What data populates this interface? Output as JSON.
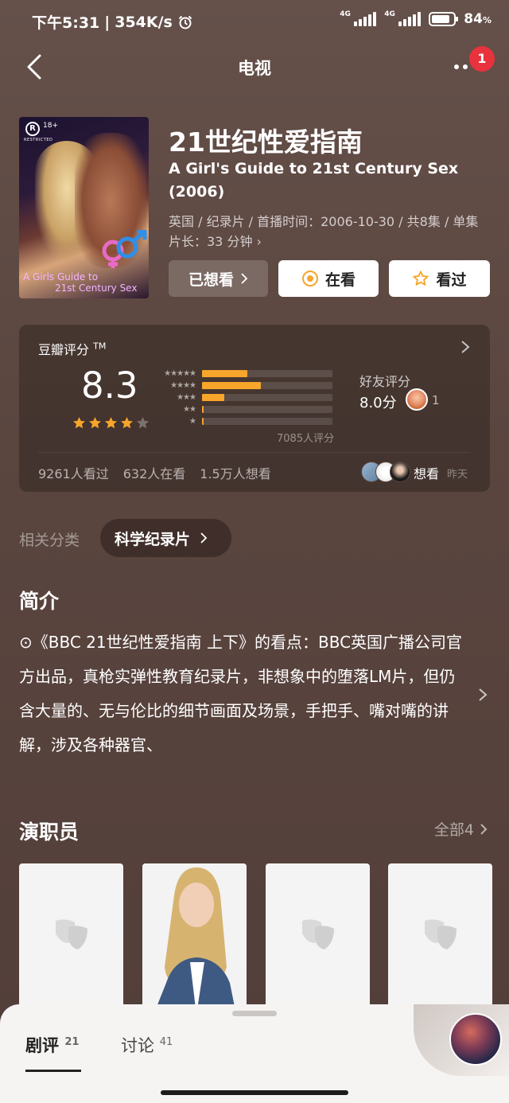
{
  "status_bar": {
    "time": "下午5:31",
    "speed": "354K/s",
    "network1": "4G",
    "network2": "4G",
    "battery": "84",
    "battery_unit": "%"
  },
  "nav": {
    "title": "电视",
    "notification_count": "1"
  },
  "poster": {
    "rating_badge": "R",
    "age": "18+",
    "restricted": "RESTRICTED",
    "line1": "A Girls Guide to",
    "line2": "21st Century Sex"
  },
  "movie": {
    "title_cn": "21世纪性爱指南",
    "title_en": "A Girl's Guide to 21st Century Sex (2006)",
    "meta": "英国 / 纪录片 / 首播时间：2006-10-30 / 共8集 / 单集片长：33 分钟 ›"
  },
  "actions": {
    "wished": "已想看",
    "watching": "在看",
    "watched": "看过"
  },
  "rating": {
    "title": "豆瓣评分",
    "tm": "TM",
    "score": "8.3",
    "stars": 4,
    "distribution": [
      0.35,
      0.45,
      0.17,
      0.015,
      0.01
    ],
    "count": "7085人评分",
    "friend_label": "好友评分",
    "friend_score": "8.0分",
    "friend_count": "1",
    "watched": "9261人看过",
    "watching": "632人在看",
    "wished": "1.5万人想看",
    "wish_label": "想看",
    "wish_time": "昨天",
    "star_color": "#f7a52b"
  },
  "category": {
    "label": "相关分类",
    "chip": "科学纪录片"
  },
  "intro": {
    "title": "简介",
    "text": "⊙《BBC 21世纪性爱指南 上下》的看点：BBC英国广播公司官方出品，真枪实弹性教育纪录片，非想象中的堕落LM片，但仍含大量的、无与伦比的细节画面及场景，手把手、嘴对嘴的讲解，涉及各种器官、"
  },
  "cast": {
    "title": "演职员",
    "all_label": "全部4"
  },
  "sheet": {
    "tab_reviews": "剧评",
    "tab_reviews_count": "21",
    "tab_discuss": "讨论",
    "tab_discuss_count": "41"
  }
}
